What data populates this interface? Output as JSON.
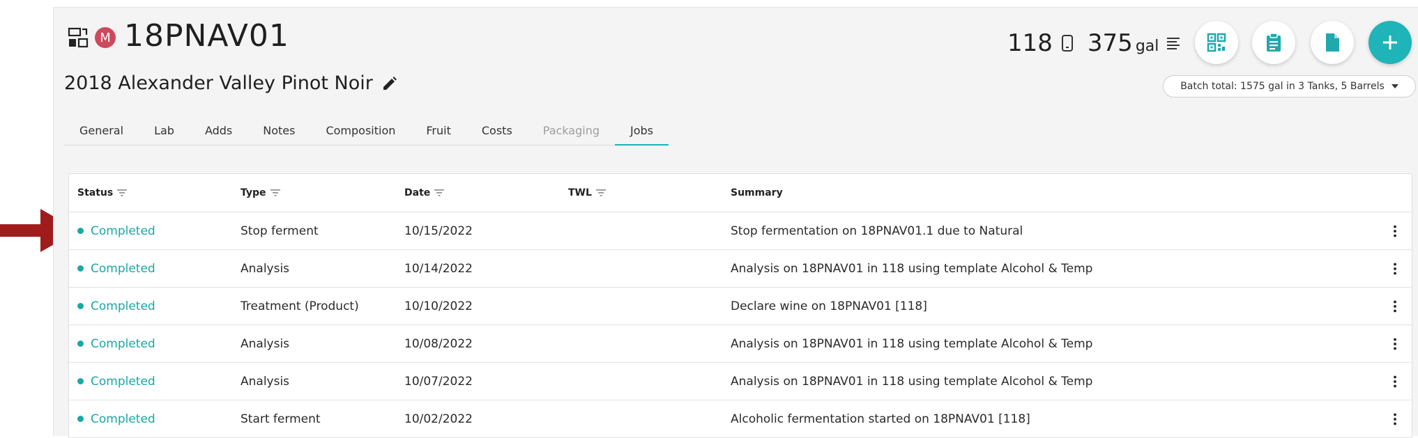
{
  "header": {
    "lot_code": "18PNAV01",
    "badge_letter": "M",
    "wine_name": "2018 Alexander Valley Pinot Noir",
    "vessel": "118",
    "volume": "375",
    "volume_unit": "gal",
    "batch_total": "Batch total: 1575 gal in 3 Tanks, 5 Barrels",
    "icons": [
      "transfer-icon",
      "tank-icon",
      "list-icon",
      "qr-code-icon",
      "clipboard-icon",
      "document-icon",
      "plus-icon",
      "pencil-icon"
    ]
  },
  "tabs": [
    {
      "label": "General",
      "state": "normal"
    },
    {
      "label": "Lab",
      "state": "normal"
    },
    {
      "label": "Adds",
      "state": "normal"
    },
    {
      "label": "Notes",
      "state": "normal"
    },
    {
      "label": "Composition",
      "state": "normal"
    },
    {
      "label": "Fruit",
      "state": "normal"
    },
    {
      "label": "Costs",
      "state": "normal"
    },
    {
      "label": "Packaging",
      "state": "disabled"
    },
    {
      "label": "Jobs",
      "state": "active"
    }
  ],
  "table": {
    "columns": [
      "Status",
      "Type",
      "Date",
      "TWL",
      "Summary"
    ],
    "rows": [
      {
        "status": "Completed",
        "type": "Stop ferment",
        "date": "10/15/2022",
        "twl": "",
        "summary": "Stop fermentation on 18PNAV01.1 due to Natural"
      },
      {
        "status": "Completed",
        "type": "Analysis",
        "date": "10/14/2022",
        "twl": "",
        "summary": "Analysis on 18PNAV01 in 118 using template Alcohol & Temp"
      },
      {
        "status": "Completed",
        "type": "Treatment (Product)",
        "date": "10/10/2022",
        "twl": "",
        "summary": "Declare wine on 18PNAV01 [118]"
      },
      {
        "status": "Completed",
        "type": "Analysis",
        "date": "10/08/2022",
        "twl": "",
        "summary": "Analysis on 18PNAV01 in 118 using template Alcohol & Temp"
      },
      {
        "status": "Completed",
        "type": "Analysis",
        "date": "10/07/2022",
        "twl": "",
        "summary": "Analysis on 18PNAV01 in 118 using template Alcohol & Temp"
      },
      {
        "status": "Completed",
        "type": "Start ferment",
        "date": "10/02/2022",
        "twl": "",
        "summary": "Alcoholic fermentation started on 18PNAV01 [118]"
      }
    ]
  },
  "colors": {
    "accent": "#1fb4b8",
    "status_completed": "#1aa7a8",
    "badge": "#cc4a5e",
    "annotation_arrow": "#a01c1c"
  }
}
